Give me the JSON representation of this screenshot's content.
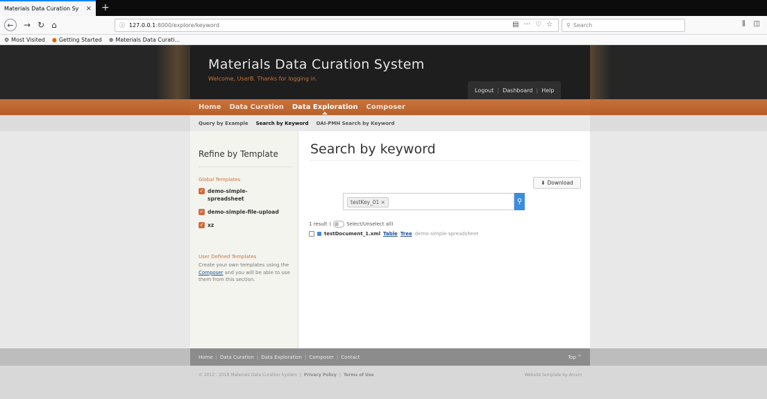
{
  "browser": {
    "tab_title": "Materials Data Curation Sy",
    "url_host": "127.0.0.1",
    "url_rest": ":8000/explore/keyword",
    "search_placeholder": "Search",
    "bookmarks": [
      "Most Visited",
      "Getting Started",
      "Materials Data Curati..."
    ]
  },
  "header": {
    "title": "Materials Data Curation System",
    "welcome": "Welcome, UserB. Thanks for logging in.",
    "user_links": [
      "Logout",
      "Dashboard",
      "Help"
    ]
  },
  "mainnav": [
    "Home",
    "Data Curation",
    "Data Exploration",
    "Composer"
  ],
  "subnav": [
    "Query by Example",
    "Search by Keyword",
    "OAI-PMH Search by Keyword"
  ],
  "sidebar": {
    "heading": "Refine by Template",
    "global_label": "Global Templates",
    "templates": [
      "demo-simple-spreadsheet",
      "demo-simple-file-upload",
      "xz"
    ],
    "user_label": "User Defined Templates",
    "user_text_before": "Create your own templates using the",
    "user_link": "Composer",
    "user_text_after": "and you will be able to use them from this section."
  },
  "main": {
    "title": "Search by keyword",
    "download_label": "Download",
    "search_tag": "testKey_01",
    "result_count": "1 result",
    "select_label": "Select/Unselect all)",
    "doc_name": "testDocument_1.xml",
    "doc_table": "Table",
    "doc_tree": "Tree",
    "doc_template": "demo-simple-spreadsheet"
  },
  "footer": {
    "links": [
      "Home",
      "Data Curation",
      "Data Exploration",
      "Composer",
      "Contact"
    ],
    "top_label": "Top ^",
    "copyright": "© 2012 - 2018 Materials Data Curation System",
    "privacy": "Privacy Policy",
    "terms": "Terms of Use",
    "credit": "Website template by Arcsin"
  }
}
